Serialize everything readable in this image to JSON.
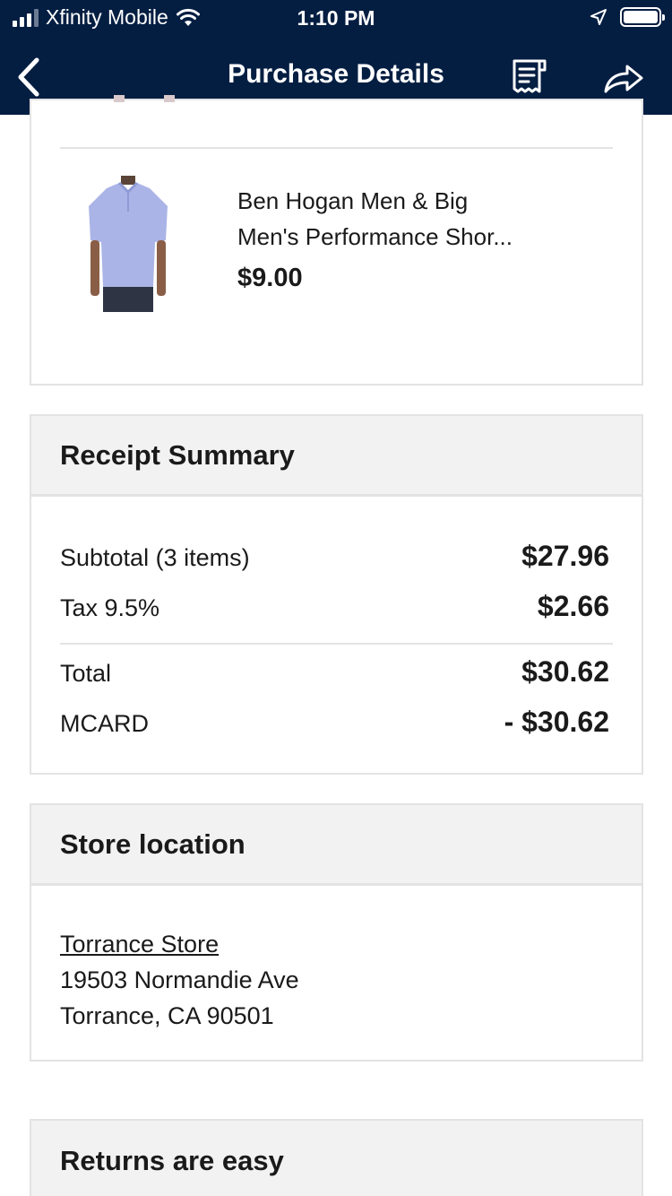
{
  "status_bar": {
    "carrier": "Xfinity Mobile",
    "time": "1:10 PM"
  },
  "nav": {
    "title": "Purchase Details",
    "back_icon": "chevron-left-icon",
    "receipt_icon": "receipt-icon",
    "share_icon": "share-icon"
  },
  "product": {
    "name_line1": "Ben Hogan Men & Big",
    "name_line2": "Men's Performance Shor...",
    "price": "$9.00"
  },
  "receipt_summary": {
    "heading": "Receipt Summary",
    "subtotal_label": "Subtotal (3 items)",
    "subtotal_value": "$27.96",
    "tax_label": "Tax 9.5%",
    "tax_value": "$2.66",
    "total_label": "Total",
    "total_value": "$30.62",
    "payment_label": "MCARD",
    "payment_value": "- $30.62"
  },
  "store_location": {
    "heading": "Store location",
    "store_name": "Torrance Store",
    "address_line1": "19503 Normandie Ave",
    "address_line2": "Torrance, CA 90501"
  },
  "returns": {
    "heading": "Returns are easy"
  },
  "colors": {
    "header_bg": "#041e42",
    "card_border": "#e3e3e3",
    "card_head_bg": "#f2f2f2",
    "shirt": "#aab4e6"
  }
}
